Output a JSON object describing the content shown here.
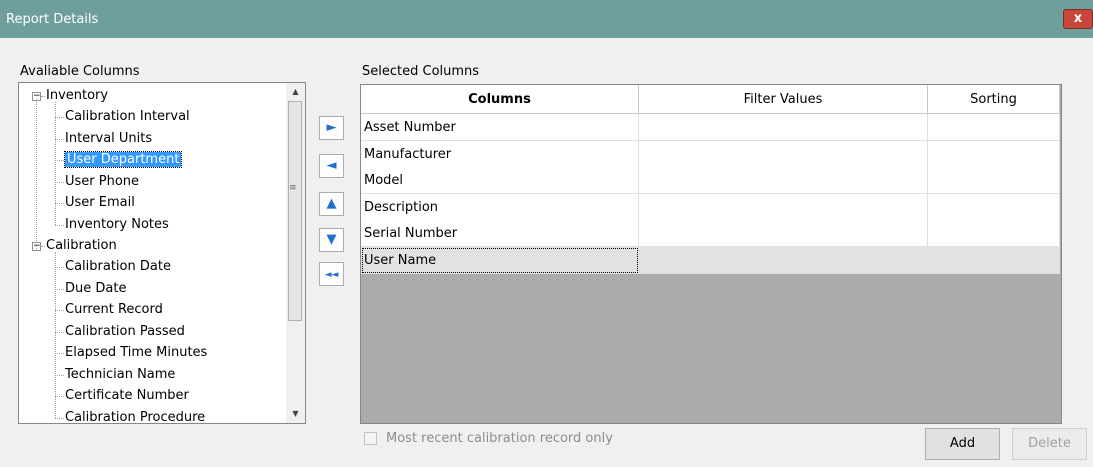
{
  "window": {
    "title": "Report Details",
    "close_glyph": "x"
  },
  "available": {
    "label": "Avaliable Columns",
    "groups": [
      {
        "name": "Inventory",
        "items": [
          "Calibration Interval",
          "Interval Units",
          "User Department",
          "User Phone",
          "User Email",
          "Inventory Notes"
        ]
      },
      {
        "name": "Calibration",
        "items": [
          "Calibration Date",
          "Due Date",
          "Current Record",
          "Calibration Passed",
          "Elapsed Time Minutes",
          "Technician Name",
          "Certificate Number",
          "Calibration Procedure"
        ]
      }
    ],
    "selected_item": "User Department"
  },
  "move_buttons": [
    {
      "name": "move-right",
      "glyph": "►"
    },
    {
      "name": "move-left",
      "glyph": "◄"
    },
    {
      "name": "move-up",
      "glyph": "▲"
    },
    {
      "name": "move-down",
      "glyph": "▼"
    },
    {
      "name": "remove-all",
      "glyph": "◄◄"
    }
  ],
  "selected": {
    "label": "Selected Columns",
    "headers": [
      "Columns",
      "Filter Values",
      "Sorting"
    ],
    "rows": [
      [
        "Asset Number",
        "",
        ""
      ],
      [
        "Manufacturer",
        "",
        ""
      ],
      [
        "Model",
        "",
        ""
      ],
      [
        "Description",
        "",
        ""
      ],
      [
        "Serial Number",
        "",
        ""
      ],
      [
        "User Name",
        "",
        ""
      ]
    ]
  },
  "footer": {
    "checkbox_label": "Most recent calibration record only",
    "add_label": "Add",
    "delete_label": "Delete"
  },
  "colors": {
    "titlebar": "#6f9f9d",
    "selection": "#3399ff",
    "grid_bg": "#ababab",
    "arrow": "#1f6fcf"
  }
}
